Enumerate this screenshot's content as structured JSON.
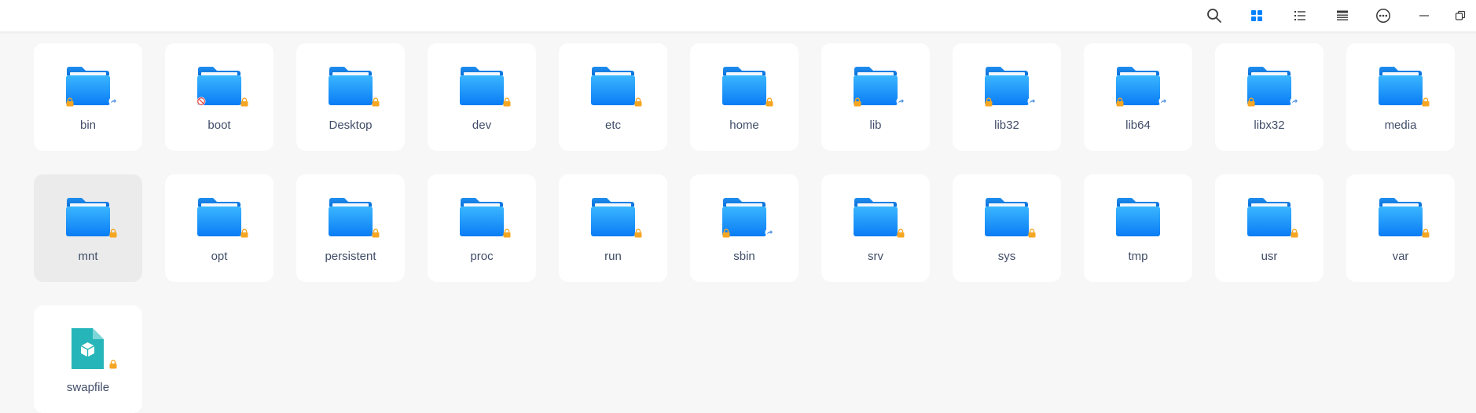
{
  "toolbar": {
    "buttons": [
      {
        "id": "search",
        "icon": "search-icon"
      },
      {
        "id": "icon-view",
        "icon": "grid-view-icon",
        "active": true
      },
      {
        "id": "list-view",
        "icon": "list-view-icon"
      },
      {
        "id": "tree-view",
        "icon": "tree-view-icon"
      },
      {
        "id": "more",
        "icon": "more-options-icon"
      },
      {
        "id": "minimize",
        "icon": "minimize-icon"
      },
      {
        "id": "restore",
        "icon": "restore-icon"
      }
    ]
  },
  "colors": {
    "accent": "#0081ff",
    "folder_top": "#33b1ff",
    "folder_bottom": "#0a7cf5",
    "lock": "#f5a623",
    "noperm": "#e34a4a",
    "file_teal": "#26b5b8"
  },
  "items": [
    {
      "name": "bin",
      "type": "folder",
      "badges": [
        "lock-left",
        "link-right"
      ]
    },
    {
      "name": "boot",
      "type": "folder",
      "badges": [
        "noperm-left",
        "lock-right"
      ]
    },
    {
      "name": "Desktop",
      "type": "folder",
      "badges": [
        "lock-right"
      ]
    },
    {
      "name": "dev",
      "type": "folder",
      "badges": [
        "lock-right"
      ]
    },
    {
      "name": "etc",
      "type": "folder",
      "badges": [
        "lock-right"
      ]
    },
    {
      "name": "home",
      "type": "folder",
      "badges": [
        "lock-right"
      ]
    },
    {
      "name": "lib",
      "type": "folder",
      "badges": [
        "lock-left",
        "link-right"
      ]
    },
    {
      "name": "lib32",
      "type": "folder",
      "badges": [
        "lock-left",
        "link-right"
      ]
    },
    {
      "name": "lib64",
      "type": "folder",
      "badges": [
        "lock-left",
        "link-right"
      ]
    },
    {
      "name": "libx32",
      "type": "folder",
      "badges": [
        "lock-left",
        "link-right"
      ]
    },
    {
      "name": "media",
      "type": "folder",
      "badges": [
        "lock-right"
      ]
    },
    {
      "name": "mnt",
      "type": "folder",
      "badges": [
        "lock-right"
      ],
      "selected": true
    },
    {
      "name": "opt",
      "type": "folder",
      "badges": [
        "lock-right"
      ]
    },
    {
      "name": "persistent",
      "type": "folder",
      "badges": [
        "lock-right"
      ]
    },
    {
      "name": "proc",
      "type": "folder",
      "badges": [
        "lock-right"
      ]
    },
    {
      "name": "run",
      "type": "folder",
      "badges": [
        "lock-right"
      ]
    },
    {
      "name": "sbin",
      "type": "folder",
      "badges": [
        "lock-left",
        "link-right"
      ]
    },
    {
      "name": "srv",
      "type": "folder",
      "badges": [
        "lock-right"
      ]
    },
    {
      "name": "sys",
      "type": "folder",
      "badges": [
        "lock-right"
      ]
    },
    {
      "name": "tmp",
      "type": "folder",
      "badges": []
    },
    {
      "name": "usr",
      "type": "folder",
      "badges": [
        "lock-right"
      ]
    },
    {
      "name": "var",
      "type": "folder",
      "badges": [
        "lock-right"
      ]
    },
    {
      "name": "swapfile",
      "type": "file",
      "badges": [
        "lock-right"
      ]
    }
  ]
}
